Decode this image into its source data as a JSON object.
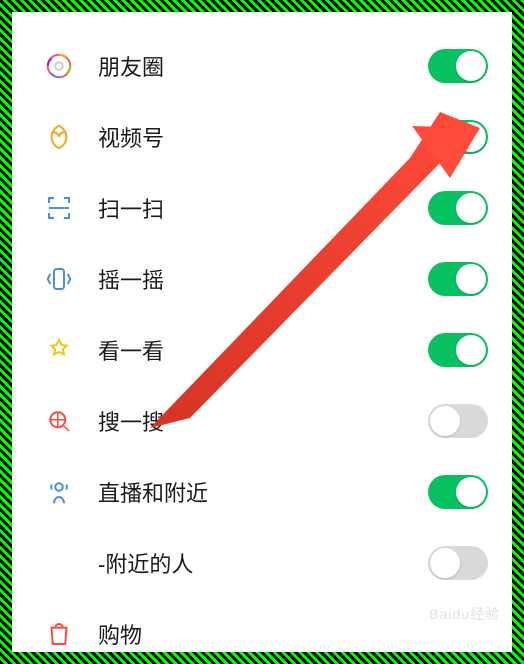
{
  "items": [
    {
      "id": "moments",
      "label": "朋友圈",
      "icon": "moments",
      "enabled": true,
      "hasIcon": true
    },
    {
      "id": "channels",
      "label": "视频号",
      "icon": "channels",
      "enabled": true,
      "hasIcon": true
    },
    {
      "id": "scan",
      "label": "扫一扫",
      "icon": "scan",
      "enabled": true,
      "hasIcon": true
    },
    {
      "id": "shake",
      "label": "摇一摇",
      "icon": "shake",
      "enabled": true,
      "hasIcon": true
    },
    {
      "id": "topstories",
      "label": "看一看",
      "icon": "eye",
      "enabled": true,
      "hasIcon": true
    },
    {
      "id": "search",
      "label": "搜一搜",
      "icon": "search",
      "enabled": false,
      "hasIcon": true
    },
    {
      "id": "nearby",
      "label": "直播和附近",
      "icon": "nearby",
      "enabled": true,
      "hasIcon": true
    },
    {
      "id": "people",
      "label": "-附近的人",
      "icon": "",
      "enabled": false,
      "hasIcon": false
    },
    {
      "id": "shopping",
      "label": "购物",
      "icon": "shopping",
      "enabled": null,
      "hasIcon": true
    }
  ],
  "annotation": {
    "arrow_target_item": "channels"
  },
  "watermark": "Baidu经验"
}
